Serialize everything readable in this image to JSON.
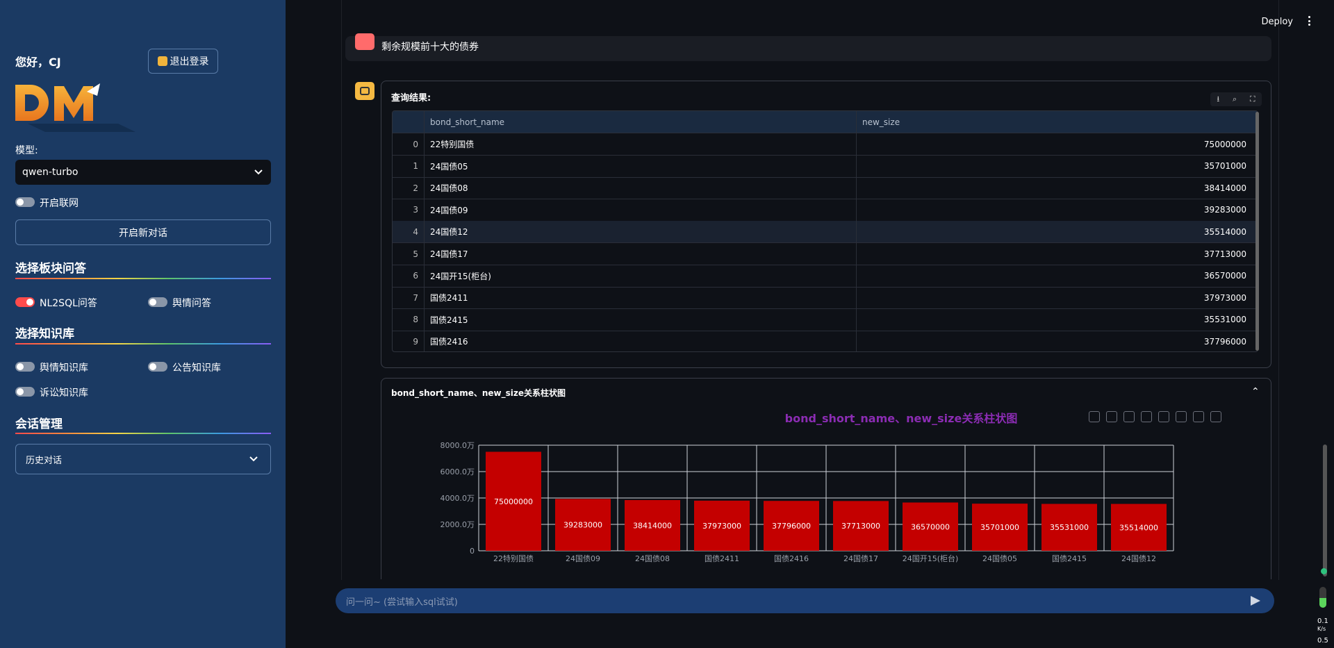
{
  "sidebar": {
    "greeting": "您好，CJ",
    "logout_label": "退出登录",
    "logo_text": "DM",
    "model_label": "模型:",
    "model_value": "qwen-turbo",
    "web_toggle_label": "开启联网",
    "new_chat_label": "开启新对话",
    "section_qa": "选择板块问答",
    "qa_nl2sql": "NL2SQL问答",
    "qa_sentiment": "舆情问答",
    "section_kb": "选择知识库",
    "kb_sentiment": "舆情知识库",
    "kb_announce": "公告知识库",
    "kb_litigation": "诉讼知识库",
    "section_session": "会话管理",
    "history_label": "历史对话"
  },
  "header": {
    "deploy_label": "Deploy"
  },
  "chat": {
    "user_message": "剩余规模前十大的债券",
    "result_title": "查询结果:",
    "table": {
      "columns": [
        "bond_short_name",
        "new_size"
      ],
      "rows": [
        {
          "idx": "0",
          "name": "22特别国债",
          "size": "75000000"
        },
        {
          "idx": "1",
          "name": "24国债05",
          "size": "35701000"
        },
        {
          "idx": "2",
          "name": "24国债08",
          "size": "38414000"
        },
        {
          "idx": "3",
          "name": "24国债09",
          "size": "39283000"
        },
        {
          "idx": "4",
          "name": "24国债12",
          "size": "35514000"
        },
        {
          "idx": "5",
          "name": "24国债17",
          "size": "37713000"
        },
        {
          "idx": "6",
          "name": "24国开15(柜台)",
          "size": "36570000"
        },
        {
          "idx": "7",
          "name": "国债2411",
          "size": "37973000"
        },
        {
          "idx": "8",
          "name": "国债2415",
          "size": "35531000"
        },
        {
          "idx": "9",
          "name": "国债2416",
          "size": "37796000"
        }
      ]
    },
    "chart_panel_title": "bond_short_name、new_size关系柱状图",
    "input_placeholder": "问一问~ (尝试输入sql试试)"
  },
  "chart_data": {
    "type": "bar",
    "title": "bond_short_name、new_size关系柱状图",
    "categories": [
      "22特别国债",
      "24国债09",
      "24国债08",
      "国债2411",
      "国债2416",
      "24国债17",
      "24国开15(柜台)",
      "24国债05",
      "国债2415",
      "24国债12"
    ],
    "values": [
      75000000,
      39283000,
      38414000,
      37973000,
      37796000,
      37713000,
      36570000,
      35701000,
      35531000,
      35514000
    ],
    "ylim": [
      0,
      80000000
    ],
    "yticks": [
      0,
      20000000,
      40000000,
      60000000,
      80000000
    ],
    "ytick_labels": [
      "0",
      "2000.0万",
      "4000.0万",
      "6000.0万",
      "8000.0万"
    ],
    "bar_color": "#c40000",
    "grid": true
  },
  "status": {
    "net_up": "0.1",
    "net_unit": "K/s",
    "net_down": "0.5"
  }
}
